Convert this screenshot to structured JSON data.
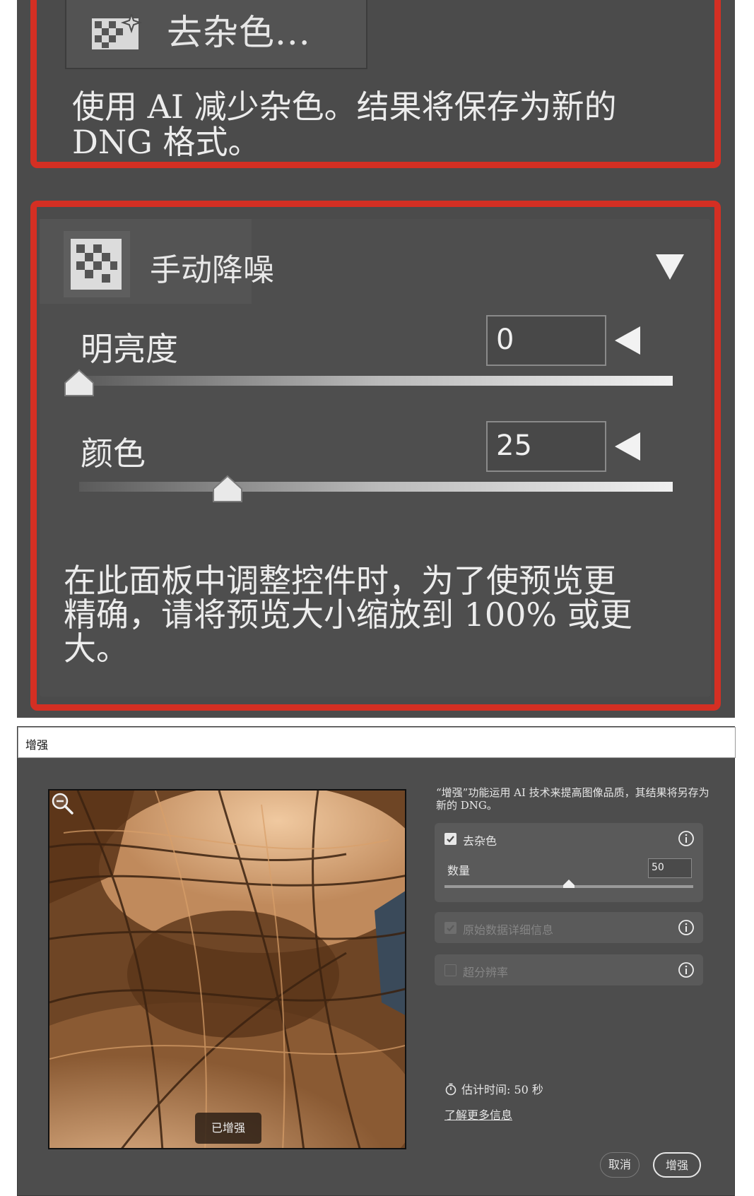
{
  "top_panel": {
    "denoise_button_label": "去杂色...",
    "description": "使用 AI 减少杂色。结果将保存为新的 DNG 格式。",
    "manual": {
      "title": "手动降噪",
      "luminance": {
        "label": "明亮度",
        "value": "0",
        "slider_value": 0
      },
      "color": {
        "label": "颜色",
        "value": "25",
        "slider_value": 25
      },
      "hint": "在此面板中调整控件时，为了使预览更精确，请将预览大小缩放到 100% 或更大。"
    },
    "highlight_color": "#d42f23"
  },
  "dialog": {
    "title": "增强",
    "description": "“增强”功能运用 AI 技术来提高图像品质，其结果将另存为新的 DNG。",
    "preview_badge": "已增强",
    "options": {
      "denoise": {
        "label": "去杂色",
        "checked": true,
        "amount_label": "数量",
        "amount_value": "50",
        "amount_slider": 50
      },
      "raw_details": {
        "label": "原始数据详细信息",
        "checked": true,
        "disabled": true
      },
      "super_resolution": {
        "label": "超分辨率",
        "checked": false,
        "disabled": true
      }
    },
    "estimated_time": "估计时间: 50 秒",
    "learn_more": "了解更多信息",
    "cancel_label": "取消",
    "enhance_label": "增强"
  }
}
